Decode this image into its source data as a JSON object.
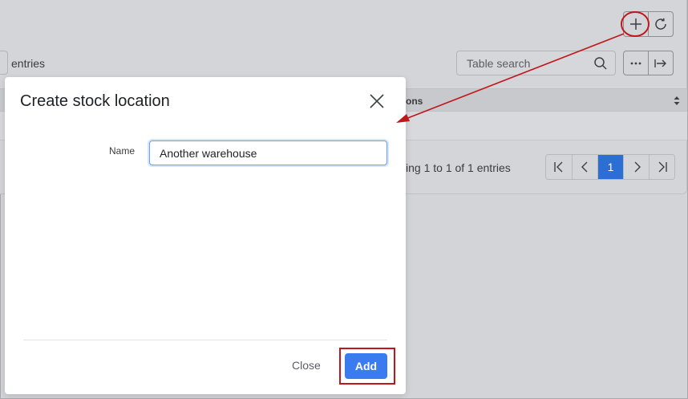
{
  "toolbar": {
    "add_icon": "plus-icon",
    "refresh_icon": "refresh-icon"
  },
  "table": {
    "entries_label": "entries",
    "search_placeholder": "Table search",
    "column_header": "ons",
    "showing": "ing 1 to 1 of 1 entries",
    "pager": {
      "current_page": "1"
    }
  },
  "modal": {
    "title": "Create stock location",
    "name_label": "Name",
    "name_value": "Another warehouse",
    "close_label": "Close",
    "add_label": "Add"
  },
  "colors": {
    "accent": "#3a7bef",
    "annotation": "#c0171b"
  }
}
